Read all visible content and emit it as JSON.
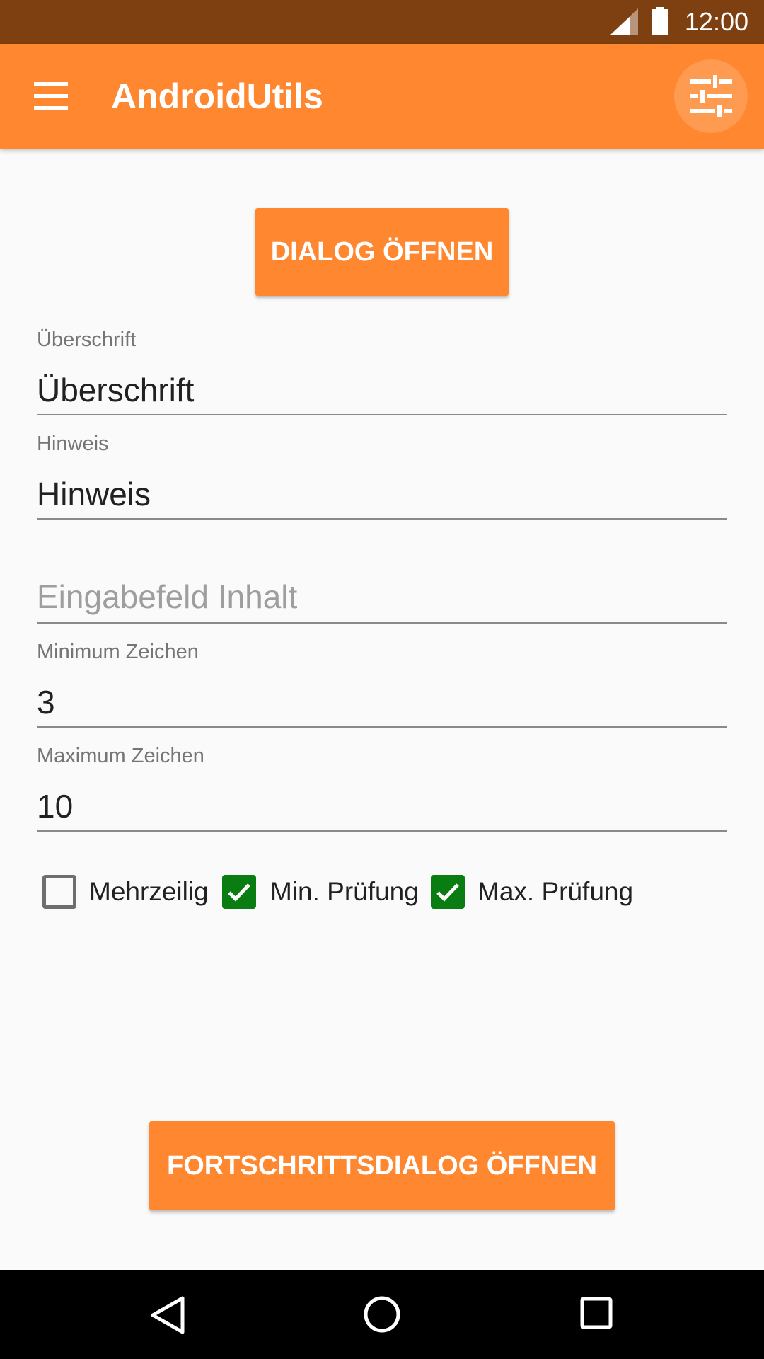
{
  "status_bar": {
    "time": "12:00",
    "icons": [
      "signal-icon",
      "battery-icon"
    ]
  },
  "app_bar": {
    "title": "AndroidUtils",
    "left_icon": "menu-icon",
    "right_icon": "tune-icon",
    "accent_color": "#ff8730"
  },
  "main": {
    "dialog_button_label": "DIALOG ÖFFNEN",
    "fields": {
      "heading": {
        "label": "Überschrift",
        "value": "Überschrift"
      },
      "hint": {
        "label": "Hinweis",
        "value": "Hinweis"
      },
      "content": {
        "placeholder": "Eingabefeld Inhalt",
        "value": ""
      },
      "min_chars": {
        "label": "Minimum Zeichen",
        "value": "3"
      },
      "max_chars": {
        "label": "Maximum Zeichen",
        "value": "10"
      }
    },
    "checkboxes": [
      {
        "label": "Mehrzeilig",
        "checked": false
      },
      {
        "label": "Min. Prüfung",
        "checked": true
      },
      {
        "label": "Max. Prüfung",
        "checked": true
      }
    ],
    "progress_button_label": "FORTSCHRITTSDIALOG ÖFFNEN",
    "checked_color": "#0a7d12"
  },
  "nav_bar": {
    "icons": [
      "back-icon",
      "home-icon",
      "recents-icon"
    ]
  }
}
